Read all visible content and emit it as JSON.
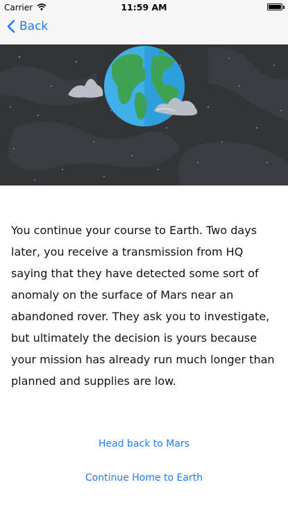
{
  "status_bar": {
    "carrier": "Carrier",
    "time": "11:59 AM",
    "battery_level": 1.0
  },
  "nav": {
    "back_label": "Back",
    "back_icon": "chevron-left-icon"
  },
  "hero": {
    "image": "earth-in-space-illustration",
    "colors": {
      "space": "#333438",
      "ocean": "#3fb0e8",
      "land": "#3ea153",
      "cloud": "#b9bec7"
    }
  },
  "story": {
    "text": "You continue your course to Earth. Two days later, you receive a transmission from HQ saying that they have detected some sort of anomaly on the surface of Mars near an abandoned rover. They ask you to investigate, but ultimately the decision is yours because your mission has already run much longer than planned and supplies are low."
  },
  "choices": [
    {
      "label": "Head back to Mars"
    },
    {
      "label": "Continue Home to Earth"
    }
  ],
  "theme": {
    "accent": "#1e7cf2",
    "nav_background": "#f7f7f7"
  }
}
